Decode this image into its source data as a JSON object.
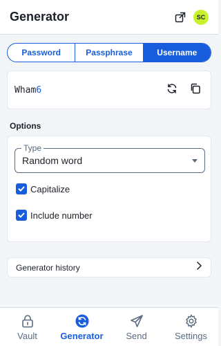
{
  "header": {
    "title": "Generator",
    "popout_icon": "popout-icon",
    "avatar_initials": "SC",
    "avatar_color": "#c9f22d"
  },
  "tabs": [
    {
      "label": "Password",
      "active": false
    },
    {
      "label": "Passphrase",
      "active": false
    },
    {
      "label": "Username",
      "active": true
    }
  ],
  "output": {
    "value_text": "Wham",
    "value_digit": "6",
    "regenerate_icon": "refresh-icon",
    "copy_icon": "copy-icon"
  },
  "options": {
    "heading": "Options",
    "type_label": "Type",
    "type_value": "Random word",
    "capitalize_label": "Capitalize",
    "capitalize_checked": true,
    "include_number_label": "Include number",
    "include_number_checked": true
  },
  "history": {
    "label": "Generator history",
    "icon": "chevron-right-icon"
  },
  "nav": [
    {
      "label": "Vault",
      "icon": "lock-icon",
      "active": false
    },
    {
      "label": "Generator",
      "icon": "generator-icon",
      "active": true
    },
    {
      "label": "Send",
      "icon": "send-icon",
      "active": false
    },
    {
      "label": "Settings",
      "icon": "gear-icon",
      "active": false
    }
  ],
  "colors": {
    "accent": "#175ddc",
    "background": "#f3f6f9",
    "text": "#1b2029",
    "muted": "#5a6a80"
  }
}
